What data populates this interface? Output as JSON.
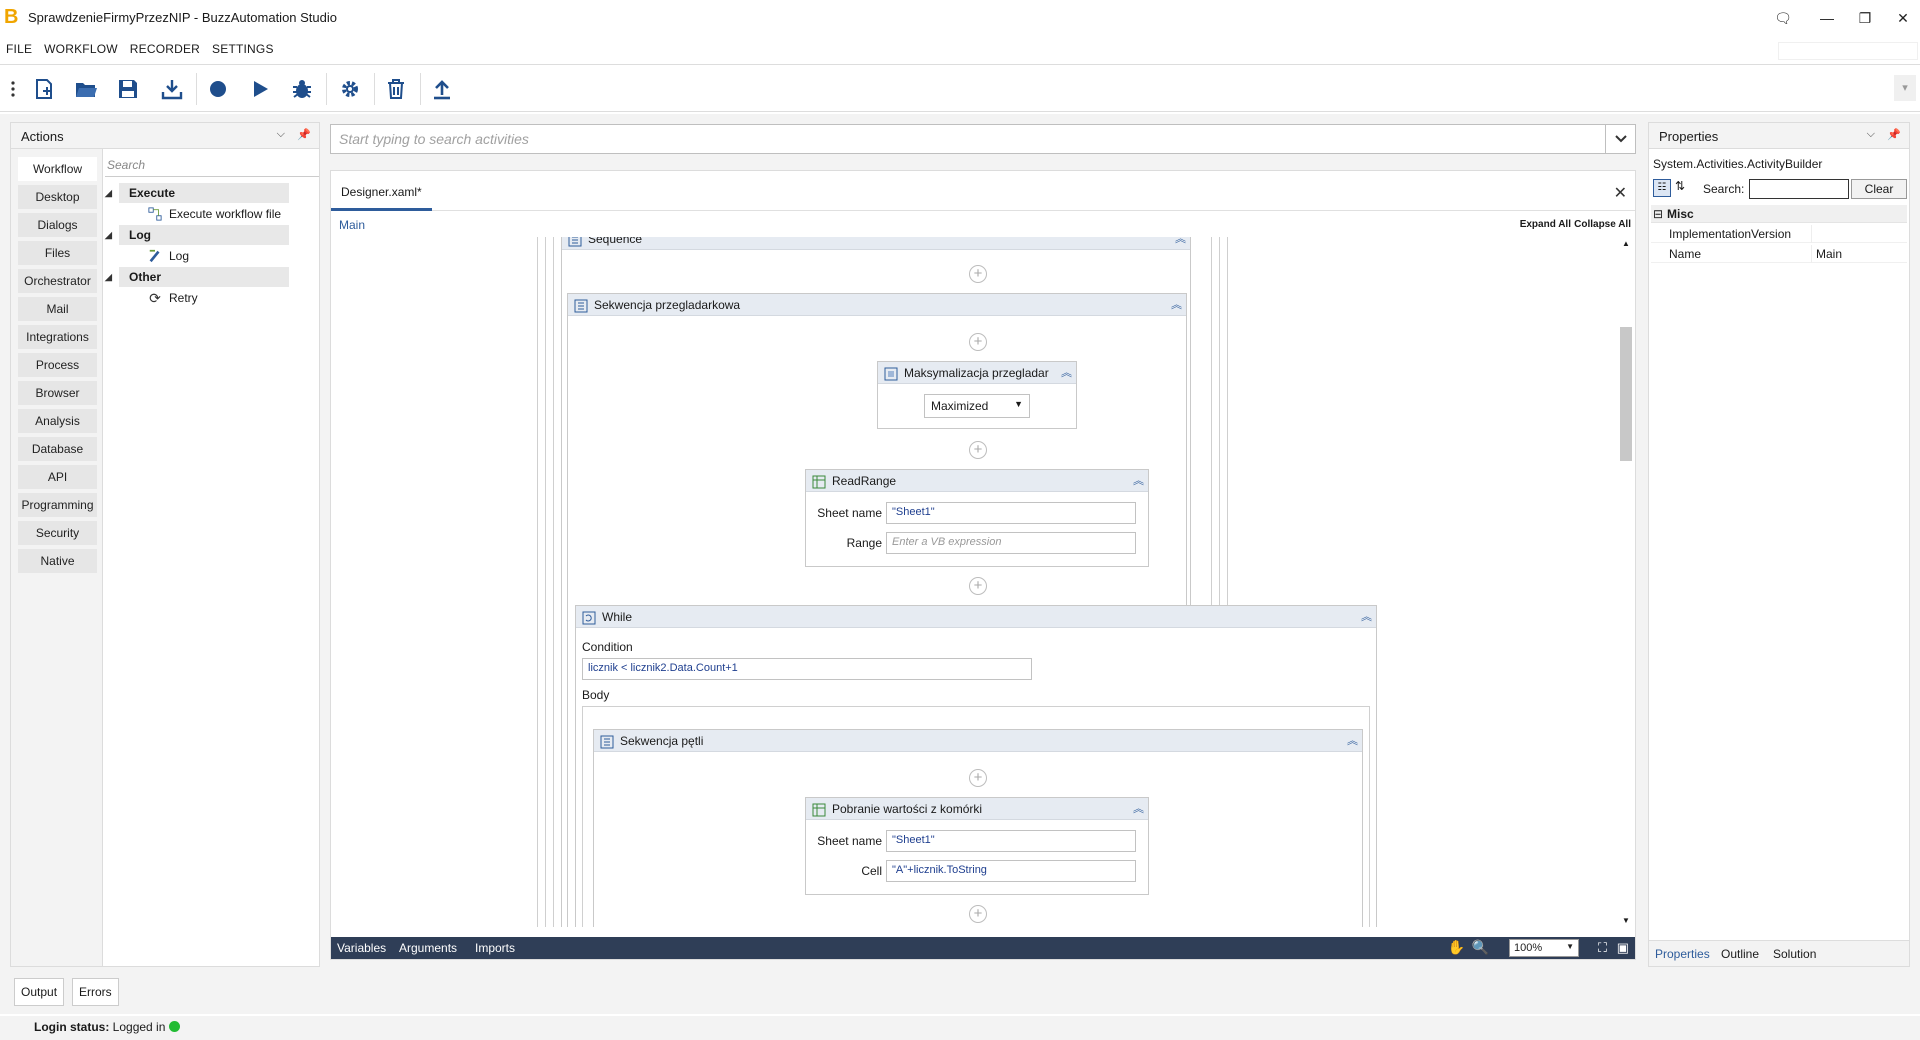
{
  "window": {
    "title": "SprawdzenieFirmyPrzezNIP - BuzzAutomation Studio",
    "logo_letter": "B",
    "controls": {
      "chat": "🗨",
      "minimize": "—",
      "restore": "❐",
      "close": "✕"
    }
  },
  "menu": [
    "FILE",
    "WORKFLOW",
    "RECORDER",
    "SETTINGS"
  ],
  "toolbar": {
    "icons": [
      "grip-icon",
      "new-file-icon",
      "open-folder-icon",
      "save-icon",
      "download-icon",
      "record-icon",
      "run-icon",
      "debug-icon",
      "settings-icon",
      "delete-icon",
      "publish-icon"
    ],
    "overflow_glyph": "▾"
  },
  "actions_panel": {
    "title": "Actions",
    "categories": [
      "Workflow",
      "Desktop",
      "Dialogs",
      "Files",
      "Orchestrator",
      "Mail",
      "Integrations",
      "Process",
      "Browser",
      "Analysis",
      "Database",
      "API",
      "Programming",
      "Security",
      "Native"
    ],
    "search_placeholder": "Search",
    "groups": [
      {
        "name": "Execute",
        "items": [
          "Execute workflow file"
        ]
      },
      {
        "name": "Log",
        "items": [
          "Log"
        ]
      },
      {
        "name": "Other",
        "items": [
          "Retry"
        ]
      }
    ]
  },
  "activity_search": {
    "placeholder": "Start typing to search activities"
  },
  "designer": {
    "tab": "Designer.xaml*",
    "breadcrumb": "Main",
    "expand_all": "Expand All",
    "collapse_all": "Collapse All",
    "activities": {
      "sequence": "Sequence",
      "browser_sequence": "Sekwencja przegladarkowa",
      "maximize": {
        "title": "Maksymalizacja przegladar",
        "value": "Maximized"
      },
      "read_range": {
        "title": "ReadRange",
        "sheet_label": "Sheet name",
        "sheet_value": "\"Sheet1\"",
        "range_label": "Range",
        "range_placeholder": "Enter a VB expression"
      },
      "while": {
        "title": "While",
        "condition_label": "Condition",
        "condition_value": "licznik < licznik2.Data.Count+1",
        "body_label": "Body"
      },
      "loop_sequence": "Sekwencja pętli",
      "get_cell": {
        "title": "Pobranie wartości z komórki",
        "sheet_label": "Sheet name",
        "sheet_value": "\"Sheet1\"",
        "cell_label": "Cell",
        "cell_value": "\"A\"+licznik.ToString"
      }
    },
    "bottom_bar": {
      "variables": "Variables",
      "arguments": "Arguments",
      "imports": "Imports",
      "zoom": "100%"
    }
  },
  "properties": {
    "title": "Properties",
    "type": "System.Activities.ActivityBuilder",
    "search_label": "Search:",
    "clear": "Clear",
    "category": "Misc",
    "rows": [
      {
        "key": "ImplementationVersion",
        "value": ""
      },
      {
        "key": "Name",
        "value": "Main"
      }
    ],
    "tabs": [
      "Properties",
      "Outline",
      "Solution"
    ]
  },
  "bottom_tabs": [
    "Output",
    "Errors"
  ],
  "status": {
    "label": "Login status:",
    "value": "Logged in",
    "color": "#22bb33"
  },
  "colors": {
    "accent": "#2e5c9b",
    "bar": "#2f3e57"
  }
}
